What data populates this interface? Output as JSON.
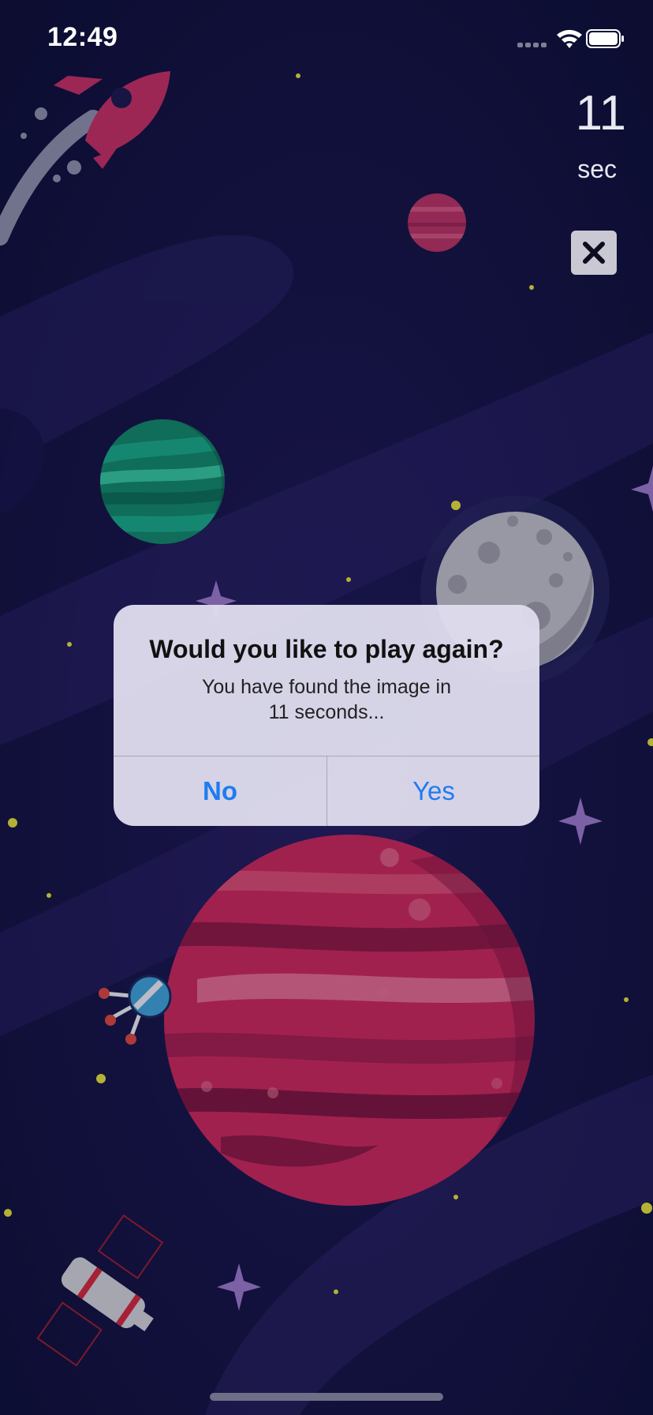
{
  "status_bar": {
    "time": "12:49",
    "signal_icon": "cellular-signal-icon",
    "wifi_icon": "wifi-icon",
    "battery_icon": "battery-icon"
  },
  "timer": {
    "value": "11",
    "unit": "sec"
  },
  "close_button": {
    "icon": "close-x-icon"
  },
  "scene": {
    "background_color": "#13133f",
    "objects": [
      "rocket",
      "small-pink-planet",
      "green-planet",
      "grey-moon",
      "large-red-planet",
      "space-probe",
      "satellite",
      "sparkle-stars"
    ]
  },
  "dialog": {
    "title": "Would you like to play again?",
    "message_line1": "You have found the image in",
    "message_line2": "11 seconds...",
    "no_label": "No",
    "yes_label": "Yes"
  },
  "colors": {
    "accent": "#1f7cf0",
    "dialog_bg": "#dedcec",
    "planet_red": "#c8285a",
    "planet_green": "#13906e"
  }
}
